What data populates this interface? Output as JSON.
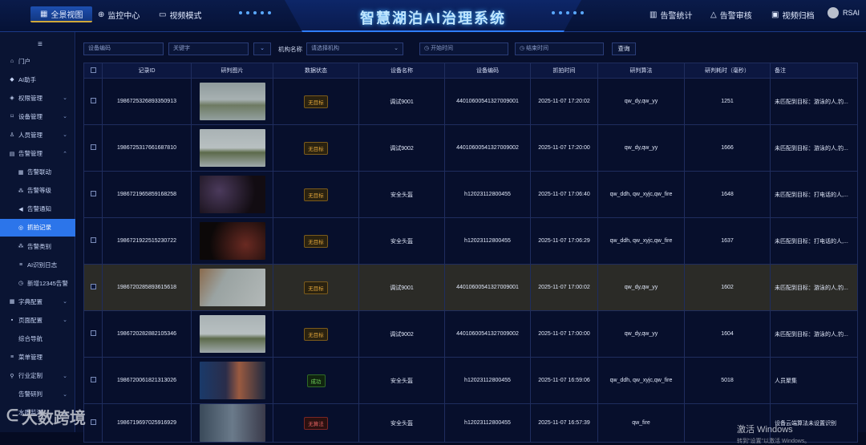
{
  "header": {
    "title": "智慧湖泊AI治理系统",
    "nav_left": [
      "全景视图",
      "监控中心",
      "视频模式"
    ],
    "nav_right": [
      "告警统计",
      "告警审核",
      "视频归档"
    ],
    "user": "RSAI"
  },
  "sidebar": {
    "menu_icon": "hamburger-icon",
    "items": [
      {
        "label": "门户",
        "icon": "home-icon"
      },
      {
        "label": "AI助手",
        "icon": "shield-icon"
      },
      {
        "label": "权限管理",
        "icon": "lock-icon"
      },
      {
        "label": "设备管理",
        "icon": "device-icon"
      },
      {
        "label": "人员管理",
        "icon": "user-icon"
      },
      {
        "label": "告警管理",
        "icon": "document-icon"
      },
      {
        "label": "告警联动",
        "icon": "grid-icon"
      },
      {
        "label": "告警等级",
        "icon": "cluster-icon"
      },
      {
        "label": "告警通知",
        "icon": "speaker-icon"
      },
      {
        "label": "抓拍记录",
        "icon": "target-icon"
      },
      {
        "label": "告警类别",
        "icon": "cluster-icon"
      },
      {
        "label": "AI识别日志",
        "icon": "list-icon"
      },
      {
        "label": "新增12345告警",
        "icon": "clock-icon"
      },
      {
        "label": "字典配置",
        "icon": "grid-icon"
      },
      {
        "label": "页面配置",
        "icon": "tiles-icon"
      },
      {
        "label": "综合导航",
        "icon": "none"
      },
      {
        "label": "菜单管理",
        "icon": "list-icon"
      },
      {
        "label": "行业定制",
        "icon": "pin-icon"
      },
      {
        "label": "告警研判",
        "icon": "none"
      },
      {
        "label": "水质监测",
        "icon": "none"
      }
    ]
  },
  "filters": {
    "device_code": "设备编码",
    "keyword": "关键字",
    "org_label": "机构名称",
    "org_placeholder": "请选择机构",
    "start_time": "开始时间",
    "end_time": "结束时间",
    "query": "查询"
  },
  "table": {
    "headers": [
      "记录ID",
      "研判图片",
      "数据状态",
      "设备名称",
      "设备编码",
      "抓拍时间",
      "研判算法",
      "研判耗时（毫秒）",
      "备注"
    ],
    "rows": [
      {
        "id": "1986725326893350913",
        "status": "无目标",
        "status_type": "none",
        "device": "调试9001",
        "code": "44010600541327009001",
        "time": "2025-11-07 17:20:02",
        "algo": "qw_dy,qw_yy",
        "ms": "1251",
        "note": "未匹配到目标：游泳的人,钓...",
        "img": "lake"
      },
      {
        "id": "1986725317661687810",
        "status": "无目标",
        "status_type": "none",
        "device": "调试9002",
        "code": "44010600541327009002",
        "time": "2025-11-07 17:20:00",
        "algo": "qw_dy,qw_yy",
        "ms": "1666",
        "note": "未匹配到目标：游泳的人,钓...",
        "img": "lake2"
      },
      {
        "id": "1986721965859168258",
        "status": "无目标",
        "status_type": "none",
        "device": "安全头盔",
        "code": "h12023112800455",
        "time": "2025-11-07 17:06:40",
        "algo": "qw_ddh, qw_xyjc,qw_fire",
        "ms": "1648",
        "note": "未匹配到目标：打电话的人,...",
        "img": "dark"
      },
      {
        "id": "1986721922515230722",
        "status": "无目标",
        "status_type": "none",
        "device": "安全头盔",
        "code": "h12023112800455",
        "time": "2025-11-07 17:06:29",
        "algo": "qw_ddh, qw_xyjc,qw_fire",
        "ms": "1637",
        "note": "未匹配到目标：打电话的人,...",
        "img": "dark2"
      },
      {
        "id": "1986720285893615618",
        "status": "无目标",
        "status_type": "none",
        "device": "调试9001",
        "code": "44010600541327009001",
        "time": "2025-11-07 17:00:02",
        "algo": "qw_dy,qw_yy",
        "ms": "1602",
        "note": "未匹配到目标：游泳的人,钓...",
        "img": "fog"
      },
      {
        "id": "1986720282882105346",
        "status": "无目标",
        "status_type": "none",
        "device": "调试9002",
        "code": "44010600541327009002",
        "time": "2025-11-07 17:00:00",
        "algo": "qw_dy,qw_yy",
        "ms": "1604",
        "note": "未匹配到目标：游泳的人,钓...",
        "img": "lake2"
      },
      {
        "id": "1986720061821313026",
        "status": "成功",
        "status_type": "ok",
        "device": "安全头盔",
        "code": "h12023112800455",
        "time": "2025-11-07 16:59:06",
        "algo": "qw_ddh, qw_xyjc,qw_fire",
        "ms": "5018",
        "note": "人员聚集",
        "img": "screen"
      },
      {
        "id": "1986719697025916929",
        "status": "无算法",
        "status_type": "lock",
        "device": "安全头盔",
        "code": "h12023112800455",
        "time": "2025-11-07 16:57:39",
        "algo": "qw_fire",
        "ms": "",
        "note": "设备云端算法未设置识别",
        "img": "screen2"
      }
    ]
  },
  "watermark": {
    "line1": "激活 Windows",
    "line2": "转到\"设置\"以激活 Windows。"
  },
  "logo_text": "大数跨境"
}
